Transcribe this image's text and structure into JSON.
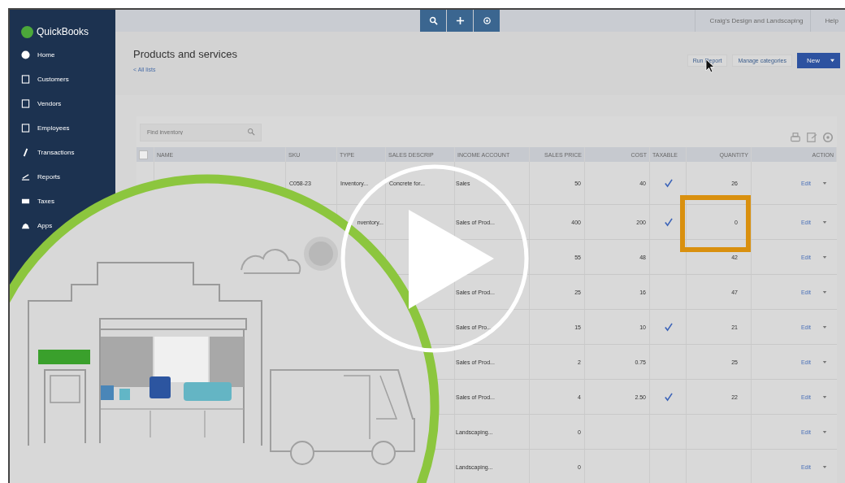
{
  "brand": {
    "name": "QuickBooks"
  },
  "sidebar": {
    "items": [
      {
        "label": "Home"
      },
      {
        "label": "Customers"
      },
      {
        "label": "Vendors"
      },
      {
        "label": "Employees"
      },
      {
        "label": "Transactions"
      },
      {
        "label": "Reports"
      },
      {
        "label": "Taxes"
      },
      {
        "label": "Apps"
      }
    ]
  },
  "top_bar": {
    "company": "Craig's Design and Landscaping",
    "help": "Help"
  },
  "header": {
    "title": "Products and services",
    "back_link": "< All lists",
    "buttons": [
      "Run Report",
      "Manage categories"
    ],
    "primary_button": "New"
  },
  "search": {
    "placeholder": "Find inventory"
  },
  "table": {
    "select_all": {
      "checked": false
    },
    "columns": [
      "NAME",
      "SKU",
      "TYPE",
      "SALES DESCRIP",
      "INCOME ACCOUNT",
      "SALES PRICE",
      "COST",
      "TAXABLE",
      "QUANTITY",
      "ACTION"
    ],
    "rows": [
      {
        "sku": "C058-23",
        "type": "Inventory...",
        "description": "Concrete for...",
        "income_account": "Sales",
        "sales_price": "50",
        "cost": "40",
        "taxable": true,
        "quantity": "26",
        "highlight": false,
        "action": "Edit"
      },
      {
        "type": "nventory...",
        "income_account": "Sales of Prod...",
        "sales_price": "400",
        "cost": "200",
        "taxable": true,
        "quantity": "0",
        "highlight": true,
        "action": "Edit"
      },
      {
        "sales_price": "55",
        "cost": "48",
        "taxable": false,
        "quantity": "42",
        "highlight": false,
        "action": "Edit"
      },
      {
        "income_account": "Sales of Prod...",
        "sales_price": "25",
        "cost": "16",
        "taxable": false,
        "quantity": "47",
        "highlight": false,
        "action": "Edit"
      },
      {
        "income_account": "Sales of Pro...",
        "sales_price": "15",
        "cost": "10",
        "taxable": true,
        "quantity": "21",
        "highlight": false,
        "action": "Edit"
      },
      {
        "income_account": "Sales of Prod...",
        "sales_price": "2",
        "cost": "0.75",
        "taxable": false,
        "quantity": "25",
        "highlight": false,
        "action": "Edit"
      },
      {
        "income_account": "Sales of Prod...",
        "sales_price": "4",
        "cost": "2.50",
        "taxable": true,
        "quantity": "22",
        "highlight": false,
        "action": "Edit"
      },
      {
        "income_account": "Landscaping...",
        "sales_price": "0",
        "taxable": false,
        "highlight": false,
        "action": "Edit"
      },
      {
        "income_account": "Landscaping...",
        "sales_price": "0",
        "taxable": false,
        "highlight": false,
        "action": "Edit"
      }
    ]
  }
}
